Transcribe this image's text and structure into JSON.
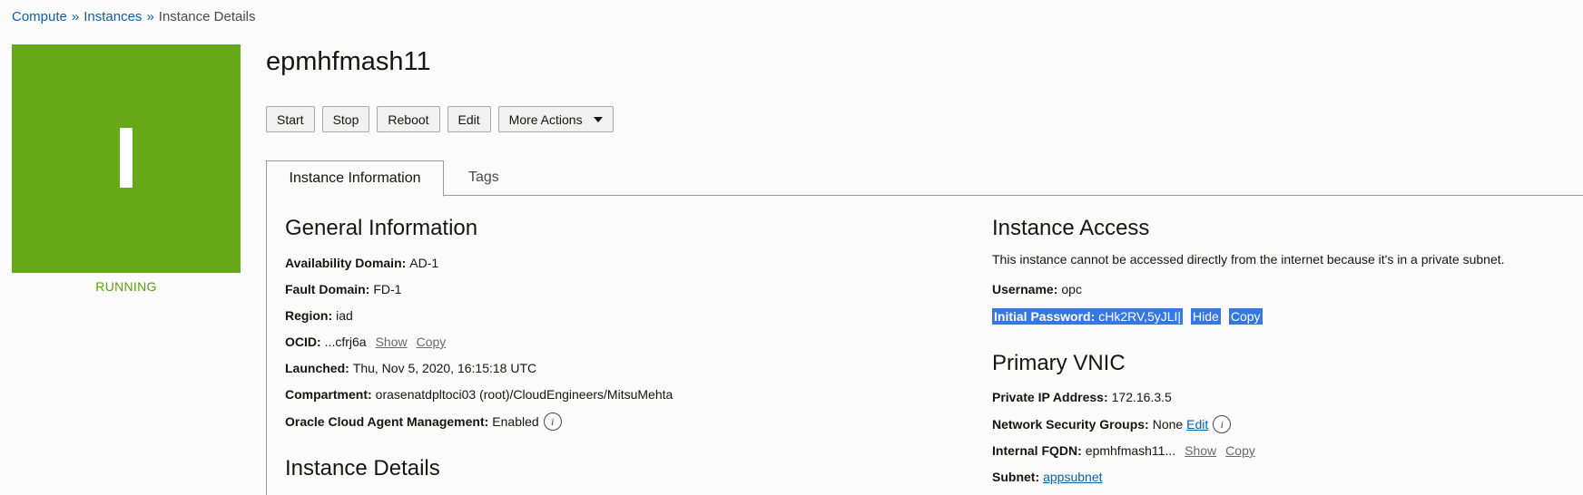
{
  "breadcrumb": {
    "items": [
      {
        "label": "Compute",
        "link": true
      },
      {
        "label": "Instances",
        "link": true
      },
      {
        "label": "Instance Details",
        "link": false
      }
    ],
    "separator": "»"
  },
  "tile": {
    "letter": "I",
    "status": "RUNNING",
    "color": "#66a817"
  },
  "instance": {
    "name": "epmhfmash11"
  },
  "actions": {
    "start": "Start",
    "stop": "Stop",
    "reboot": "Reboot",
    "edit": "Edit",
    "more": "More Actions"
  },
  "tabs": {
    "info": "Instance Information",
    "tags": "Tags"
  },
  "general": {
    "heading": "General Information",
    "availability_domain": {
      "label": "Availability Domain:",
      "value": "AD-1"
    },
    "fault_domain": {
      "label": "Fault Domain:",
      "value": "FD-1"
    },
    "region": {
      "label": "Region:",
      "value": "iad"
    },
    "ocid": {
      "label": "OCID:",
      "value": "...cfrj6a",
      "show": "Show",
      "copy": "Copy"
    },
    "launched": {
      "label": "Launched:",
      "value": "Thu, Nov 5, 2020, 16:15:18 UTC"
    },
    "compartment": {
      "label": "Compartment:",
      "value": "orasenatdpltoci03 (root)/CloudEngineers/MitsuMehta"
    },
    "agent": {
      "label": "Oracle Cloud Agent Management:",
      "value": "Enabled"
    }
  },
  "instance_details": {
    "heading": "Instance Details"
  },
  "access": {
    "heading": "Instance Access",
    "description": "This instance cannot be accessed directly from the internet because it's in a private subnet.",
    "username": {
      "label": "Username:",
      "value": "opc"
    },
    "password": {
      "label": "Initial Password:",
      "value": "cHk2RV,5yJLI|",
      "hide": "Hide",
      "copy": "Copy"
    }
  },
  "vnic": {
    "heading": "Primary VNIC",
    "private_ip": {
      "label": "Private IP Address:",
      "value": "172.16.3.5"
    },
    "nsg": {
      "label": "Network Security Groups:",
      "value": "None",
      "edit": "Edit"
    },
    "fqdn": {
      "label": "Internal FQDN:",
      "value": "epmhfmash11...",
      "show": "Show",
      "copy": "Copy"
    },
    "subnet": {
      "label": "Subnet:",
      "value": "appsubnet"
    }
  },
  "colors": {
    "accent": "#0b5fab",
    "running": "#5a9e14",
    "selection": "#3478e0"
  }
}
